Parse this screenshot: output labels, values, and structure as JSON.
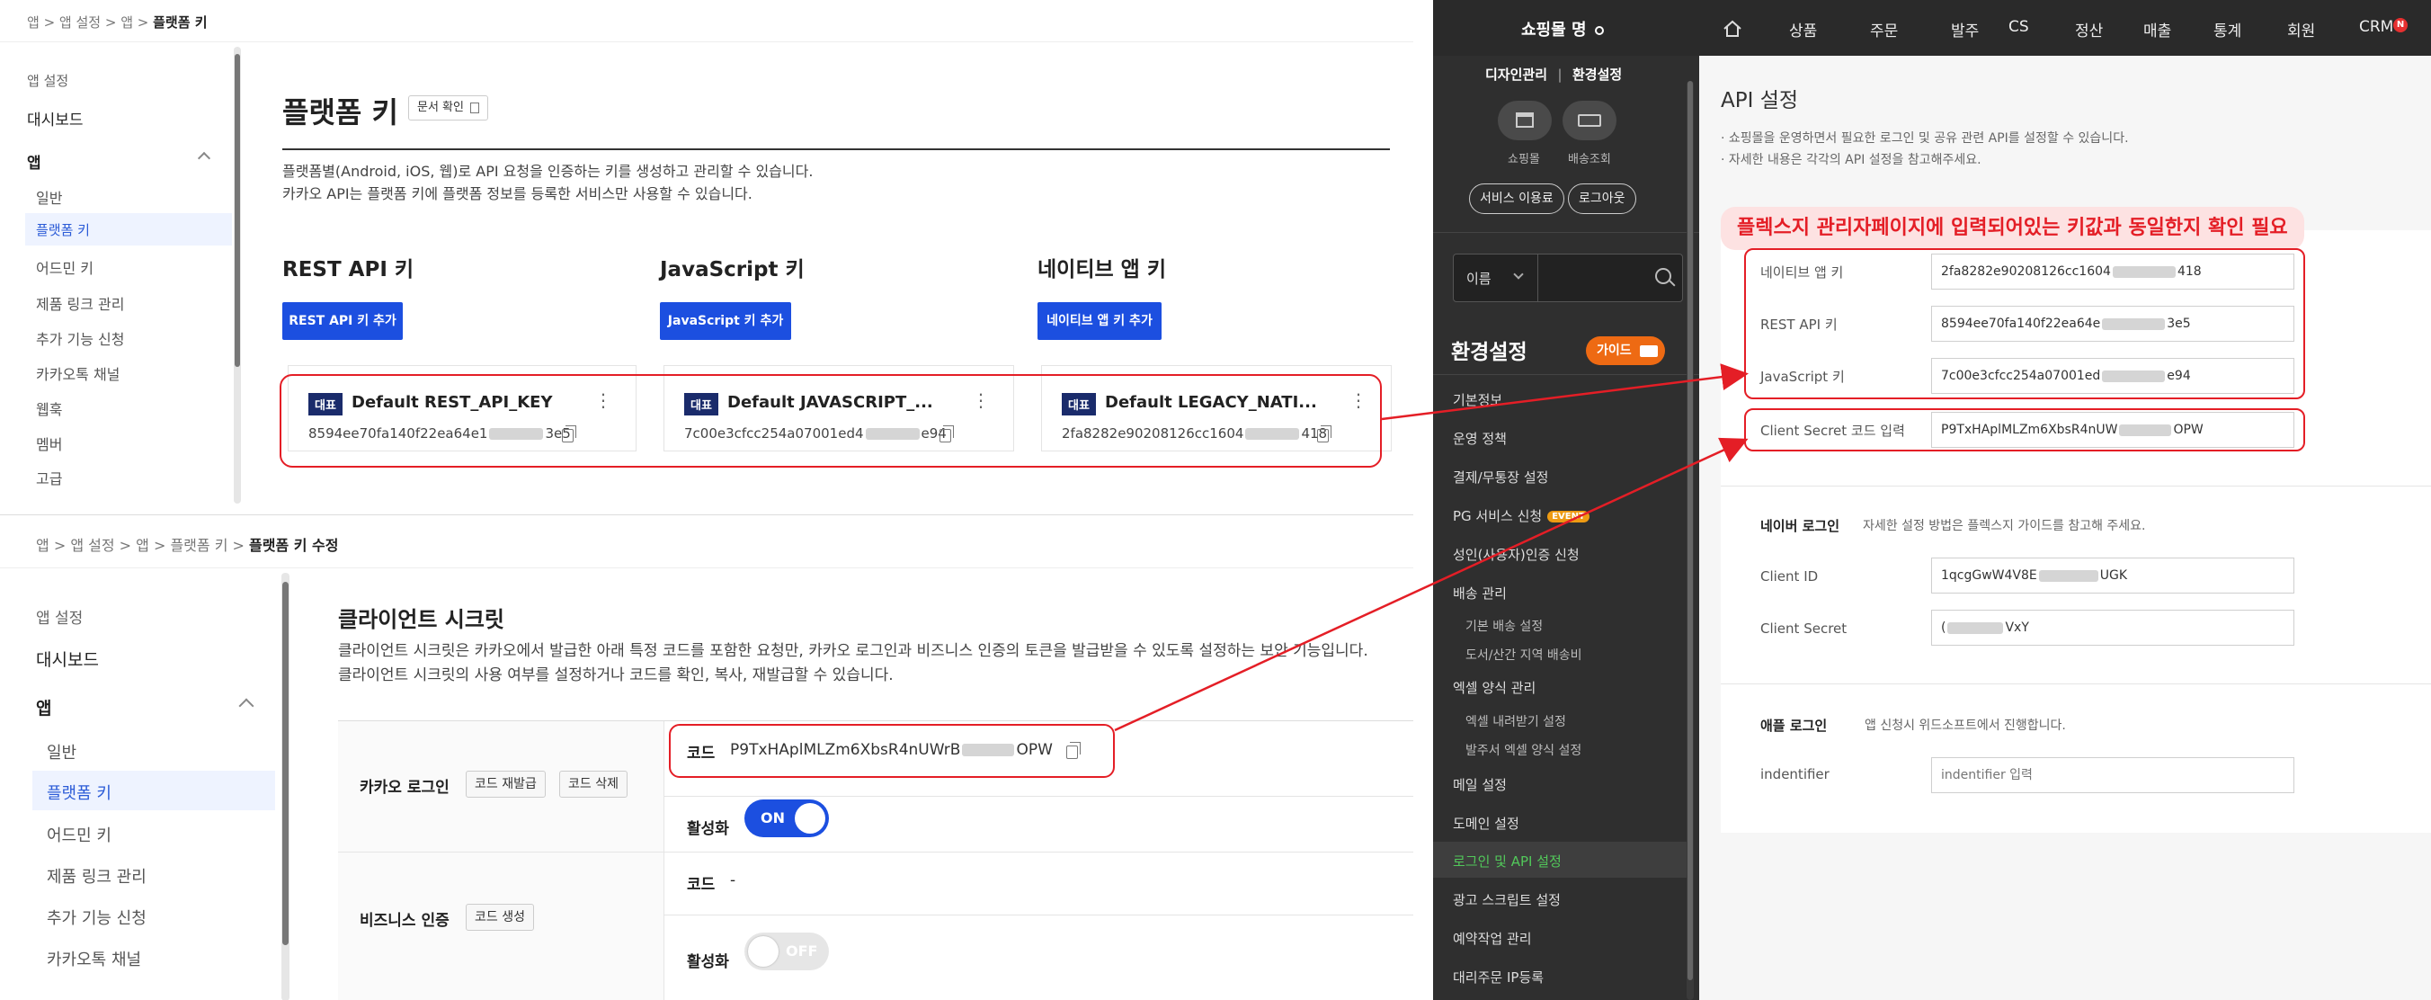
{
  "top_panel": {
    "breadcrumb": [
      "앱",
      "앱 설정",
      "앱",
      "플랫폼 키"
    ],
    "sidebar": [
      "앱 설정",
      "대시보드",
      "앱",
      "일반",
      "플랫폼 키",
      "어드민 키",
      "제품 링크 관리",
      "추가 기능 신청",
      "카카오톡 채널",
      "웹훅",
      "멤버",
      "고급"
    ],
    "title": "플랫폼 키",
    "doc_button": "문서 확인",
    "desc1": "플랫폼별(Android, iOS, 웹)로 API 요청을 인증하는 키를 생성하고 관리할 수 있습니다.",
    "desc2": "카카오 API는 플랫폼 키에 플랫폼 정보를 등록한 서비스만 사용할 수 있습니다.",
    "rest": {
      "heading": "REST API 키",
      "button": "REST API 키 추가",
      "tag": "대표",
      "name": "Default REST_API_KEY",
      "value_a": "8594ee70fa140f22ea64e1",
      "value_b": "3e5"
    },
    "js": {
      "heading": "JavaScript 키",
      "button": "JavaScript 키 추가",
      "tag": "대표",
      "name": "Default JAVASCRIPT_...",
      "value_a": "7c00e3cfcc254a07001ed4",
      "value_b": "e94"
    },
    "native": {
      "heading": "네이티브 앱 키",
      "button": "네이티브 앱 키 추가",
      "tag": "대표",
      "name": "Default LEGACY_NATI...",
      "value_a": "2fa8282e90208126cc1604",
      "value_b": "418"
    }
  },
  "bottom_panel": {
    "breadcrumb": [
      "앱",
      "앱 설정",
      "앱",
      "플랫폼 키",
      "플랫폼 키 수정"
    ],
    "sidebar": [
      "앱 설정",
      "대시보드",
      "앱",
      "일반",
      "플랫폼 키",
      "어드민 키",
      "제품 링크 관리",
      "추가 기능 신청",
      "카카오톡 채널"
    ],
    "title": "클라이언트 시크릿",
    "desc1": "클라이언트 시크릿은 카카오에서 발급한 아래 특정 코드를 포함한 요청만, 카카오 로그인과 비즈니스 인증의 토큰을 발급받을 수 있도록 설정하는 보안 기능입니다.",
    "desc2": "클라이언트 시크릿의 사용 여부를 설정하거나 코드를 확인, 복사, 재발급할 수 있습니다.",
    "kakao_login": {
      "label": "카카오 로그인",
      "reissue": "코드 재발급",
      "delete": "코드 삭제",
      "code_label": "코드",
      "code_a": "P9TxHAplMLZm6XbsR4nUWrB",
      "code_b": "OPW",
      "active_label": "활성화",
      "toggle": "ON"
    },
    "business": {
      "label": "비즈니스 인증",
      "create": "코드 생성",
      "code_label": "코드",
      "code_value": "-",
      "active_label": "활성화",
      "toggle": "OFF"
    }
  },
  "shop": {
    "logo": "쇼핑몰 명",
    "topnav": [
      "상품",
      "주문",
      "발주",
      "CS",
      "정산",
      "매출",
      "통계",
      "회원",
      "CRM"
    ],
    "crm_badge": "N",
    "tabs": [
      "디자인관리",
      "환경설정"
    ],
    "icon_labels": [
      "쇼핑몰",
      "배송조회"
    ],
    "pills": [
      "서비스 이용료",
      "로그아웃"
    ],
    "search_select": "이름",
    "section_title": "환경설정",
    "guide_button": "가이드",
    "menu": [
      "기본정보",
      "운영 정책",
      "결제/무통장 설정",
      "PG 서비스 신청",
      "성인(사용자)인증 신청",
      "배송 관리",
      "기본 배송 설정",
      "도서/산간 지역 배송비",
      "엑셀 양식 관리",
      "엑셀 내려받기 설정",
      "발주서 엑셀 양식 설정",
      "메일 설정",
      "도메인 설정",
      "로그인 및 API 설정",
      "광고 스크립트 설정",
      "예약작업 관리",
      "대리주문 IP등록"
    ],
    "event_badge": "EVENT",
    "api_title": "API 설정",
    "api_desc1": "· 쇼핑몰을 운영하면서 필요한 로그인 및 공유 관련 API를 설정할 수 있습니다.",
    "api_desc2": "· 자세한 내용은 각각의 API 설정을 참고해주세요.",
    "annotation": "플렉스지 관리자페이지에 입력되어있는 키값과 동일한지 확인 필요",
    "fields": [
      {
        "label": "네이티브 앱 키",
        "value_a": "2fa8282e90208126cc1604",
        "value_b": "418"
      },
      {
        "label": "REST API 키",
        "value_a": "8594ee70fa140f22ea64e",
        "value_b": "3e5"
      },
      {
        "label": "JavaScript 키",
        "value_a": "7c00e3cfcc254a07001ed",
        "value_b": "e94"
      }
    ],
    "client_secret": {
      "label": "Client Secret 코드 입력",
      "value_a": "P9TxHAplMLZm6XbsR4nUW",
      "value_b": "OPW"
    },
    "naver": {
      "heading": "네이버 로그인",
      "desc": "자세한 설정 방법은 플렉스지 가이드를 참고해 주세요.",
      "id_label": "Client ID",
      "id_a": "1qcgGwW4V8E",
      "id_b": "UGK",
      "secret_label": "Client Secret",
      "secret_a": "(",
      "secret_b": "VxY"
    },
    "apple": {
      "heading": "애플 로그인",
      "desc": "앱 신청시 위드소프트에서 진행합니다.",
      "id_label": "indentifier",
      "placeholder": "indentifier 입력"
    }
  },
  "colors": {
    "accent": "#1c4fe0",
    "annotation_red": "#e41e26",
    "dark_nav": "#2f2f2f",
    "guide_orange": "#ee6a13"
  }
}
